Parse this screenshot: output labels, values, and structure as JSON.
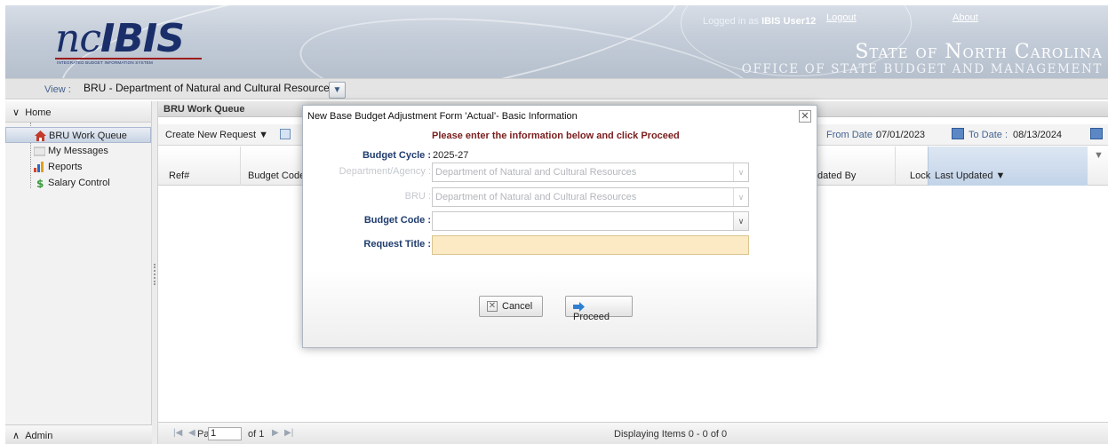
{
  "header": {
    "logo_nc": "nc",
    "logo_ibis": "IBIS",
    "logo_tagline": "INTEGRATED BUDGET INFORMATION SYSTEM",
    "logged_in_prefix": "Logged in as ",
    "logged_in_user": "IBIS User12",
    "logout": "Logout",
    "about": "About",
    "state_title": "State of North Carolina",
    "office_title": "OFFICE OF STATE BUDGET AND MANAGEMENT"
  },
  "viewbar": {
    "label": "View :",
    "selected": "BRU - Department of Natural and Cultural Resources"
  },
  "sidebar": {
    "home": "Home",
    "items": [
      {
        "label": "BRU Work Queue",
        "icon": "home-icon"
      },
      {
        "label": "My Messages",
        "icon": "message-icon"
      },
      {
        "label": "Reports",
        "icon": "bar-chart-icon"
      },
      {
        "label": "Salary Control",
        "icon": "dollar-icon"
      }
    ],
    "admin": "Admin"
  },
  "main": {
    "title": "BRU Work Queue",
    "create_label": "Create New Request ▼",
    "from_label": "From Date :",
    "from_date": "07/01/2023",
    "to_label": "To Date :",
    "to_date": "08/13/2024",
    "columns": {
      "ref": "Ref#",
      "budget_code": "Budget Code",
      "updated_by": "dated By",
      "lock": "Lock",
      "last_updated": "Last Updated ▼"
    },
    "pager": {
      "page_label": "Page",
      "page_value": "1",
      "of_label": "of 1",
      "displaying": "Displaying Items 0 - 0 of 0"
    }
  },
  "modal": {
    "title": "New Base Budget Adjustment Form 'Actual'- Basic Information",
    "instruction": "Please enter the information below and click Proceed",
    "fields": {
      "budget_cycle_label": "Budget Cycle :",
      "budget_cycle_value": "2025-27",
      "department_label": "Department/Agency :",
      "department_value": "Department of Natural and Cultural Resources",
      "bru_label": "BRU :",
      "bru_value": "Department of Natural and Cultural Resources",
      "budget_code_label": "Budget Code :",
      "budget_code_value": "",
      "request_title_label": "Request Title :",
      "request_title_value": ""
    },
    "cancel_label": "Cancel",
    "proceed_label": "Proceed"
  },
  "colors": {
    "brand_navy": "#1a2f6a",
    "instruction_red": "#7a1d1d",
    "label_blue": "#1f3c6e",
    "required_field_bg": "#fbeac3"
  }
}
